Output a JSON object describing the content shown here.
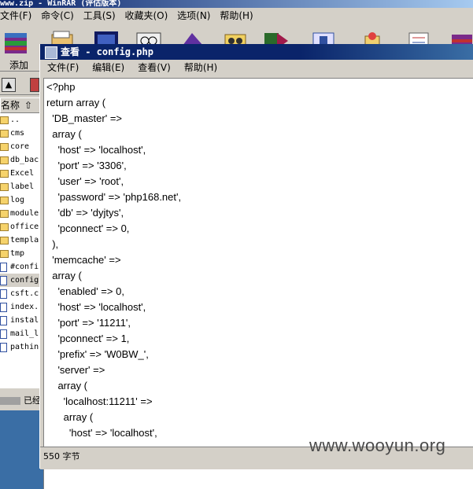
{
  "rar": {
    "title": "www.zip - WinRAR (评估版本)",
    "menu": [
      "文件(F)",
      "命令(C)",
      "工具(S)",
      "收藏夹(O)",
      "选项(N)",
      "帮助(H)"
    ],
    "add_label": "添加",
    "col_name": "名称",
    "files": [
      {
        "name": "..",
        "kind": "folder"
      },
      {
        "name": "cms",
        "kind": "folder"
      },
      {
        "name": "core",
        "kind": "folder"
      },
      {
        "name": "db_back",
        "kind": "folder"
      },
      {
        "name": "Excel",
        "kind": "folder"
      },
      {
        "name": "label",
        "kind": "folder"
      },
      {
        "name": "log",
        "kind": "folder"
      },
      {
        "name": "module",
        "kind": "folder"
      },
      {
        "name": "office",
        "kind": "folder"
      },
      {
        "name": "templa",
        "kind": "folder"
      },
      {
        "name": "tmp",
        "kind": "folder"
      },
      {
        "name": "#confi",
        "kind": "file"
      },
      {
        "name": "config",
        "kind": "file",
        "selected": true
      },
      {
        "name": "csft.c",
        "kind": "file"
      },
      {
        "name": "index.",
        "kind": "file"
      },
      {
        "name": "instal",
        "kind": "file"
      },
      {
        "name": "mail_l",
        "kind": "file"
      },
      {
        "name": "pathin",
        "kind": "file"
      }
    ],
    "status": "已经"
  },
  "viewer": {
    "title": "查看 - config.php",
    "menu": [
      "文件(F)",
      "编辑(E)",
      "查看(V)",
      "帮助(H)"
    ],
    "lines": [
      "<?php",
      "return array (",
      "  'DB_master' =>",
      "  array (",
      "    'host' => 'localhost',",
      "    'port' => '3306',",
      "    'user' => 'root',",
      "    'password' => 'php168.net',",
      "    'db' => 'dyjtys',",
      "    'pconnect' => 0,",
      "  ),",
      "  'memcache' =>",
      "  array (",
      "    'enabled' => 0,",
      "    'host' => 'localhost',",
      "    'port' => '11211',",
      "    'pconnect' => 1,",
      "    'prefix' => 'W0BW_',",
      "    'server' =>",
      "    array (",
      "      'localhost:11211' =>",
      "      array (",
      "        'host' => 'localhost',"
    ],
    "status": "550 字节"
  },
  "watermark": "www.wooyun.org"
}
